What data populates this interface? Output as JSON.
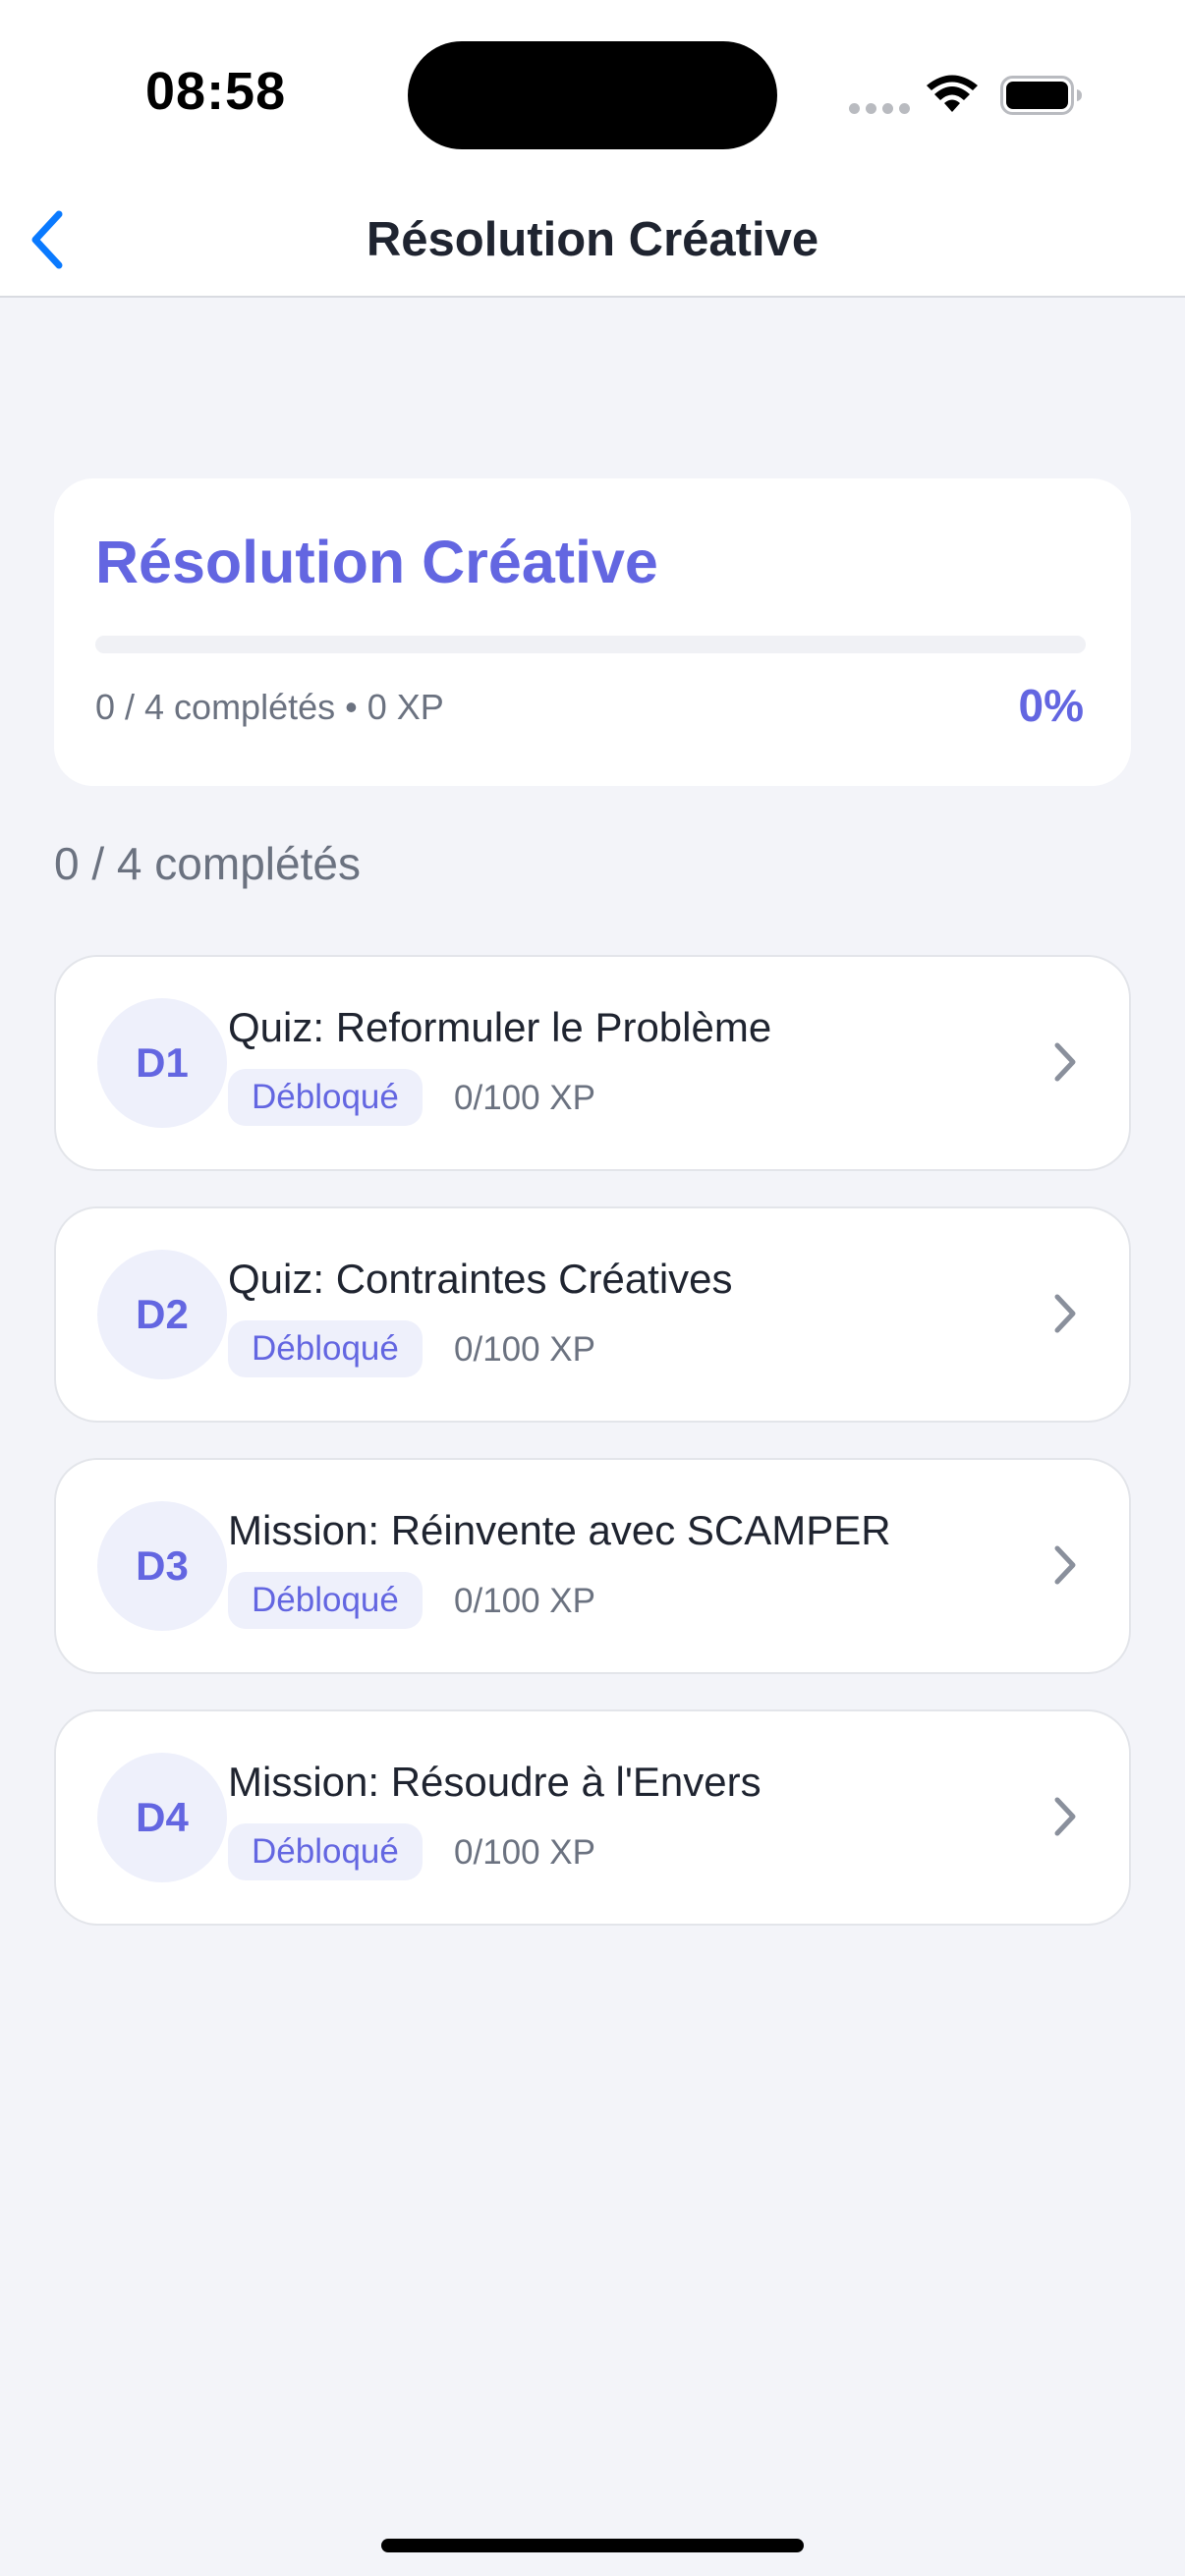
{
  "status_bar": {
    "time": "08:58"
  },
  "nav": {
    "title": "Résolution Créative",
    "back_icon": "chevron-left-icon"
  },
  "progress_card": {
    "title": "Résolution Créative",
    "progress_fraction": 0,
    "meta": "0 / 4 complétés • 0 XP",
    "percent": "0%"
  },
  "list_header": "0 / 4 complétés",
  "challenges": [
    {
      "badge": "D1",
      "title": "Quiz: Reformuler le Problème",
      "status": "Débloqué",
      "xp": "0/100 XP"
    },
    {
      "badge": "D2",
      "title": "Quiz: Contraintes Créatives",
      "status": "Débloqué",
      "xp": "0/100 XP"
    },
    {
      "badge": "D3",
      "title": "Mission: Réinvente avec SCAMPER",
      "status": "Débloqué",
      "xp": "0/100 XP"
    },
    {
      "badge": "D4",
      "title": "Mission: Résoudre à l'Envers",
      "status": "Débloqué",
      "xp": "0/100 XP"
    }
  ],
  "colors": {
    "accent": "#6366E1",
    "background": "#F3F4F9",
    "ios_blue": "#0A7AFF"
  }
}
